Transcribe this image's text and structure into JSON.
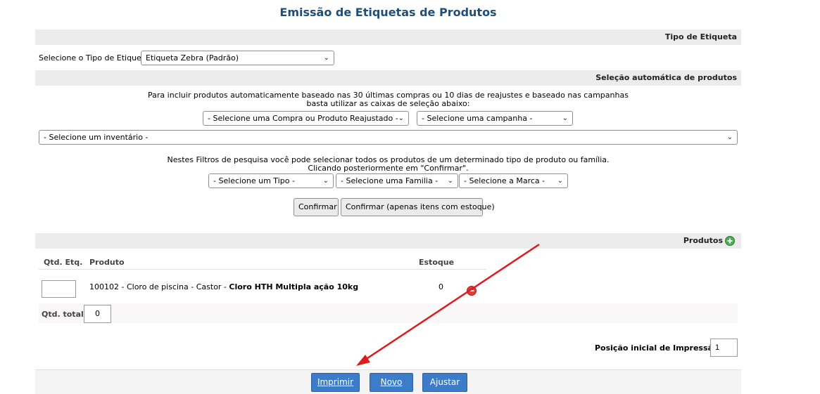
{
  "title": "Emissão de Etiquetas de Produtos",
  "tipo_etiqueta": {
    "header": "Tipo de Etiqueta",
    "label": "Selecione o Tipo de Etiqueta:",
    "selected": "Etiqueta Zebra (Padrão)"
  },
  "selecao_auto": {
    "header": "Seleção automática de produtos",
    "info_line1": "Para incluir produtos automaticamente baseado nas 30 últimas compras ou 10 dias de reajustes e baseado nas campanhas",
    "info_line2": "basta utilizar as caixas de seleção abaixo:",
    "compra_select": "- Selecione uma Compra ou Produto Reajustado -",
    "campanha_select": "- Selecione uma campanha -",
    "inventario_select": "- Selecione um inventário -"
  },
  "filtros": {
    "info_line1": "Nestes Filtros de pesquisa você pode selecionar todos os produtos de um determinado tipo de produto ou família.",
    "info_line2": "Clicando posteriormente em \"Confirmar\".",
    "tipo_select": "- Selecione um Tipo -",
    "familia_select": "- Selecione uma Familia -",
    "marca_select": "- Selecione a Marca -",
    "confirmar_label": "Confirmar",
    "confirmar_estoque_label": "Confirmar (apenas itens com estoque)"
  },
  "produtos": {
    "header": "Produtos",
    "add_icon": "plus-circle-icon",
    "columns": {
      "qtd": "Qtd. Etq.",
      "produto": "Produto",
      "estoque": "Estoque"
    },
    "rows": [
      {
        "qtd": "",
        "produto_prefix": "100102 - Cloro de piscina - Castor - ",
        "produto_bold": "Cloro HTH Multipla ação 10kg",
        "estoque": "0",
        "remove_icon": "minus-circle-icon"
      }
    ],
    "qtd_total_label": "Qtd. total:",
    "qtd_total_value": "0",
    "posicao_label": "Posição inicial de Impressão:",
    "posicao_value": "1"
  },
  "actions": {
    "imprimir": "Imprimir",
    "novo": "Novo",
    "ajustar": "Ajustar"
  },
  "colors": {
    "title": "#1f4e79",
    "section_bar": "#ececec",
    "action_button": "#3d7cc9",
    "add_icon": "#4caf50",
    "remove_icon": "#e53935",
    "annotation_arrow": "#e01b1b"
  }
}
